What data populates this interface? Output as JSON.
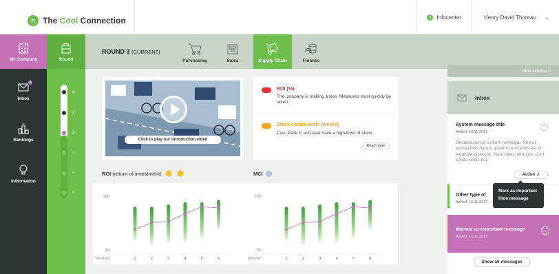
{
  "logo": {
    "prefix": "The ",
    "accent": "Cool",
    "suffix": " Connection",
    "mark": "h"
  },
  "header": {
    "infocenter": "Infocenter",
    "user": "Henry David Thoreau"
  },
  "leftnav": {
    "my_company": "My Company",
    "inbox": "Inbox",
    "inbox_badge": "3",
    "rankings": "Rankings",
    "information": "Information"
  },
  "round": {
    "label": "Round",
    "title": "ROUND 3",
    "current": "(CURRENT)",
    "numbers": [
      "1",
      "2",
      "3",
      "4",
      "5",
      "6"
    ]
  },
  "tabs": {
    "purchasing": "Purchasing",
    "sales": "Sales",
    "supply_chain": "Supply Chain",
    "finance": "Finance"
  },
  "hide_sidebar": "Hide sidebar »",
  "video": {
    "caption": "Click to play our introduction video"
  },
  "alerts": {
    "roi_title": "ROI (%)",
    "roi_body": "The company is making a loss. Measures must quickly be taken.",
    "stock_title": "Stock components (weeks)",
    "stock_body": "Can, Pack 1l and Acai have a high level of stock.",
    "read_more": "Read more"
  },
  "charts": {
    "roi_title_bold": "ROI",
    "roi_title_rest": " (return of investment)",
    "mci_title": "MCI"
  },
  "chart_data": [
    {
      "type": "line",
      "title": "ROI (return of investment)",
      "x_label": "ROUND:",
      "categories": [
        "1",
        "2",
        "3",
        "4",
        "5",
        "6"
      ],
      "y_ticks": [
        "25%",
        "0%"
      ],
      "ylim": [
        0,
        25
      ],
      "series": [
        {
          "values": [
            10,
            13,
            13.5,
            17,
            20,
            19.5
          ]
        }
      ],
      "range_low": [
        5,
        3,
        4,
        4,
        6,
        10
      ],
      "range_high": [
        20,
        20,
        21,
        22,
        22,
        23
      ]
    },
    {
      "type": "line",
      "title": "MCI",
      "x_label": "ROUND:",
      "categories": [
        "1",
        "2",
        "3",
        "4",
        "5",
        "6"
      ],
      "y_ticks": [
        "25%",
        "0%"
      ],
      "ylim": [
        0,
        25
      ],
      "series": [
        {
          "values": [
            10,
            13,
            13.5,
            17,
            20,
            19.5
          ]
        }
      ],
      "range_low": [
        5,
        3,
        4,
        4,
        6,
        10
      ],
      "range_high": [
        20,
        20,
        21,
        22,
        22,
        23
      ]
    }
  ],
  "inbox": {
    "title": "Inbox",
    "msg1_title": "System message title",
    "msg1_date": "Added: 10.11.2017",
    "msg1_body": "Detailed text of system message. Sed ut perspiciatis harum quidem rem facilis est et expedita distinctio. Nam libero tempore, cum soluta nobis est.",
    "action": "Action",
    "menu_important": "Mark as important",
    "menu_hide": "Hide message",
    "msg2_title": "Other type of",
    "msg2_date": "Added: 10.11.2017",
    "msg3_title": "Marked as important message",
    "msg3_date": "Added: 10.11.2017",
    "show_all": "Show all messages"
  },
  "colors": {
    "green": "#6cbf4b",
    "purple": "#c571b7",
    "dark": "#2f3437",
    "red": "#e0343a",
    "orange": "#f2a61f"
  }
}
